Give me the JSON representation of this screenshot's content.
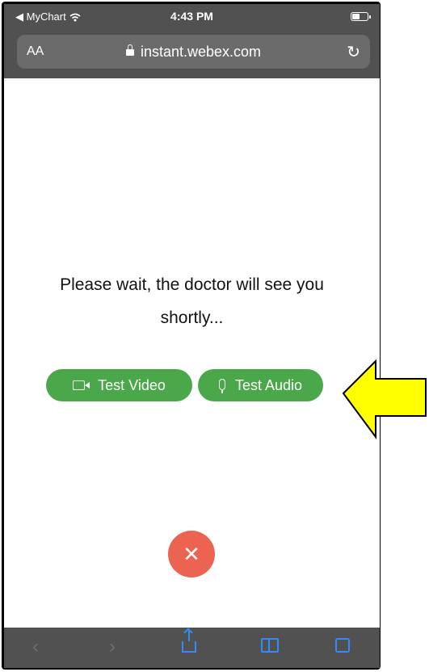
{
  "status_bar": {
    "back_app": "◀ MyChart",
    "time": "4:43 PM"
  },
  "address_bar": {
    "text_size_label": "AA",
    "domain": "instant.webex.com"
  },
  "page": {
    "message": "Please wait, the doctor will see you shortly...",
    "buttons": {
      "test_video": "Test Video",
      "test_audio": "Test Audio"
    },
    "hangup_symbol": "✕"
  },
  "colors": {
    "button_green": "#4aa84a",
    "hangup_red": "#ec6351",
    "safari_blue": "#2f8cff",
    "annotation_yellow": "#ffff00"
  },
  "icons": [
    "wifi-icon",
    "battery-icon",
    "lock-icon",
    "reload-icon",
    "camera-icon",
    "microphone-icon",
    "close-icon",
    "back-icon",
    "forward-icon",
    "share-icon",
    "bookmarks-icon",
    "tabs-icon",
    "yellow-arrow-icon"
  ]
}
